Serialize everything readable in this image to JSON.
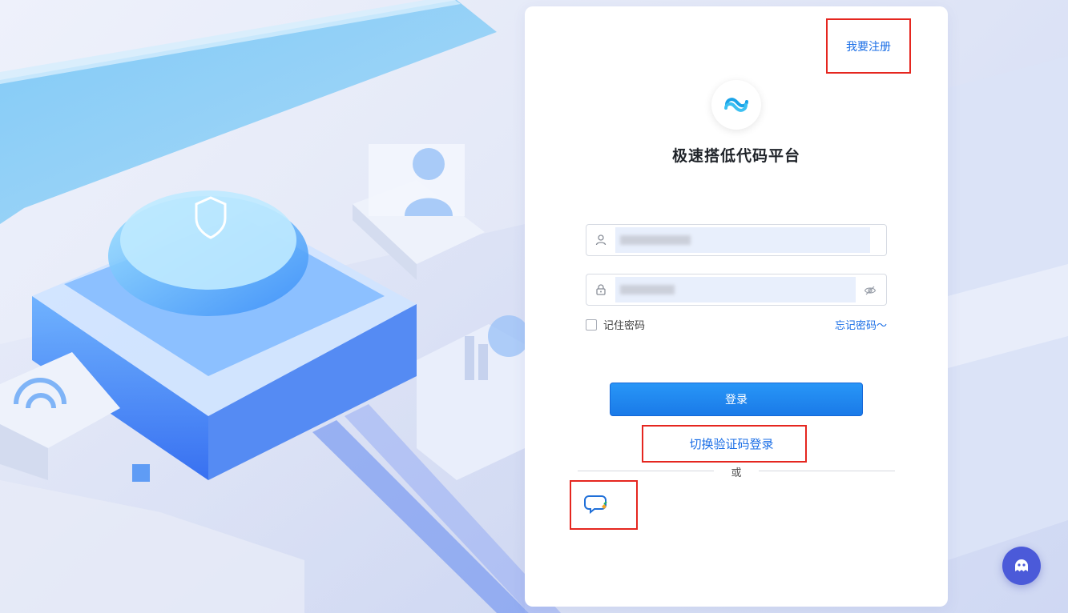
{
  "header": {
    "register_label": "我要注册"
  },
  "brand": {
    "title": "极速搭低代码平台",
    "logo_icon": "infinity-link-logo",
    "accent": "#1a6ee6"
  },
  "form": {
    "username": {
      "icon": "user-icon"
    },
    "password": {
      "icon": "lock-icon",
      "toggle_icon": "eye-hidden-icon"
    },
    "remember_label": "记住密码",
    "forgot_label": "忘记密码～",
    "login_label": "登录",
    "switch_label": "切换验证码登录",
    "or_label": "或"
  },
  "alt_login": {
    "icon": "chat-bubble-icon"
  },
  "assistant": {
    "icon": "bot-icon",
    "color": "#4b5ad9"
  }
}
